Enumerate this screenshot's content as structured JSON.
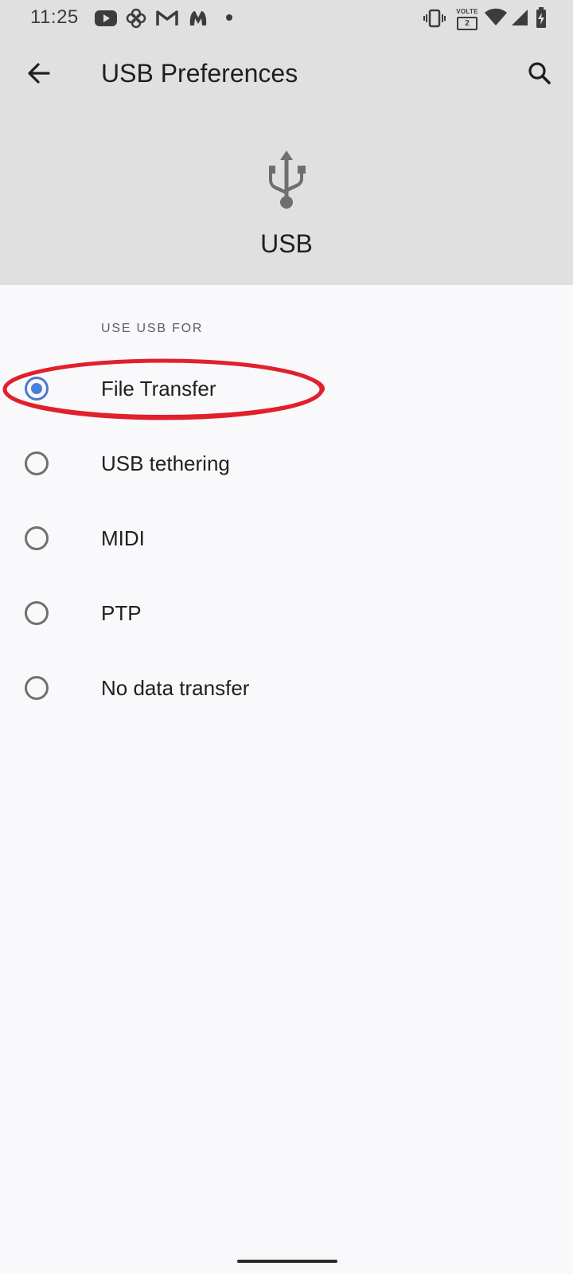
{
  "status_bar": {
    "time": "11:25",
    "network_badge_top": "VOLTE",
    "network_badge_bottom": "2",
    "icons": [
      "youtube-icon",
      "fan-icon",
      "gmail-icon",
      "malwarebytes-icon",
      "dot-icon",
      "vibrate-icon",
      "volte-icon",
      "wifi-icon",
      "signal-icon",
      "battery-icon"
    ]
  },
  "toolbar": {
    "title": "USB Preferences",
    "back_icon": "back-arrow-icon",
    "search_icon": "search-icon"
  },
  "hero": {
    "icon": "usb-icon",
    "title": "USB"
  },
  "section": {
    "header": "USE USB FOR"
  },
  "options": [
    {
      "label": "File Transfer",
      "checked": true
    },
    {
      "label": "USB tethering",
      "checked": false
    },
    {
      "label": "MIDI",
      "checked": false
    },
    {
      "label": "PTP",
      "checked": false
    },
    {
      "label": "No data transfer",
      "checked": false
    }
  ],
  "colors": {
    "header_bg": "#e0e0e0",
    "page_bg": "#f9f8fb",
    "radio_checked": "#4a7fe0",
    "annotation": "#e0202a"
  }
}
